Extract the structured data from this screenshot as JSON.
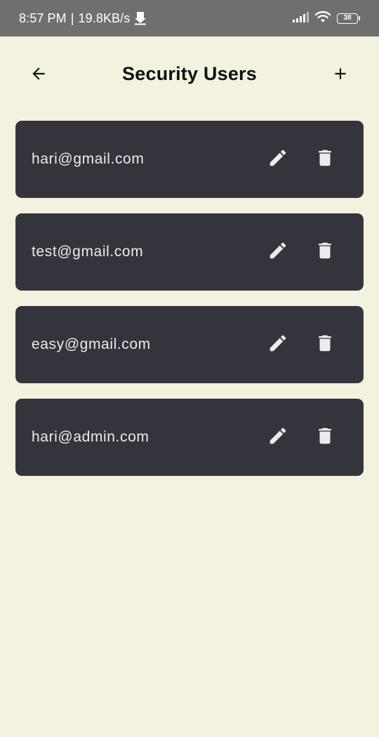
{
  "status_bar": {
    "time": "8:57 PM",
    "separator": "|",
    "net_speed": "19.8KB/s",
    "battery": "38",
    "icons": [
      "download-icon",
      "signal-icon",
      "wifi-icon",
      "battery-icon"
    ]
  },
  "app_bar": {
    "title": "Security Users",
    "back_icon": "arrow-back-icon",
    "add_icon": "plus-icon"
  },
  "users": [
    {
      "email": "hari@gmail.com"
    },
    {
      "email": "test@gmail.com"
    },
    {
      "email": "easy@gmail.com"
    },
    {
      "email": "hari@admin.com"
    }
  ],
  "row_icons": {
    "edit": "pencil-icon",
    "delete": "trash-icon"
  },
  "colors": {
    "background": "#f3f2df",
    "status_bar": "#6f6f6f",
    "card": "#34343c",
    "card_text": "#ecebf2",
    "title": "#111111"
  }
}
